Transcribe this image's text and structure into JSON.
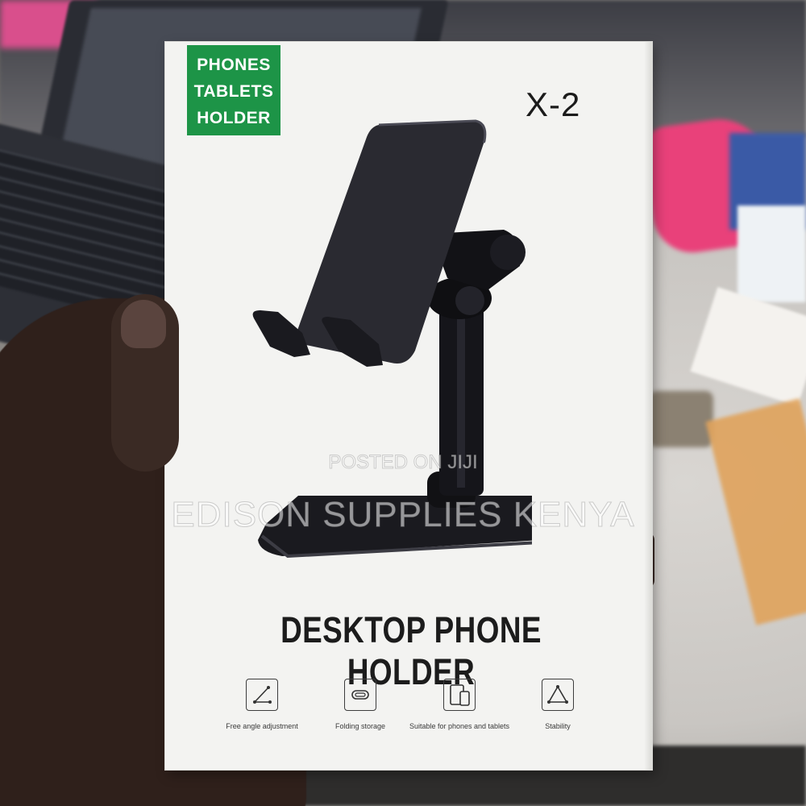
{
  "box": {
    "badge_lines": [
      "PHONES",
      "TABLETS",
      "HOLDER"
    ],
    "model": "X-2",
    "title": "DESKTOP PHONE HOLDER",
    "features": [
      {
        "icon": "angle-adjust-icon",
        "label": "Free angle adjustment"
      },
      {
        "icon": "folding-storage-icon",
        "label": "Folding storage"
      },
      {
        "icon": "phone-tablet-icon",
        "label": "Suitable for phones and tablets"
      },
      {
        "icon": "triangle-stability-icon",
        "label": "Stability"
      }
    ],
    "colors": {
      "badge": "#1d9447",
      "box": "#f3f3f1",
      "stand": "#1a1a1f"
    }
  },
  "watermark": {
    "line1": "POSTED ON JIJI",
    "line2": "EDISON SUPPLIES KENYA"
  }
}
